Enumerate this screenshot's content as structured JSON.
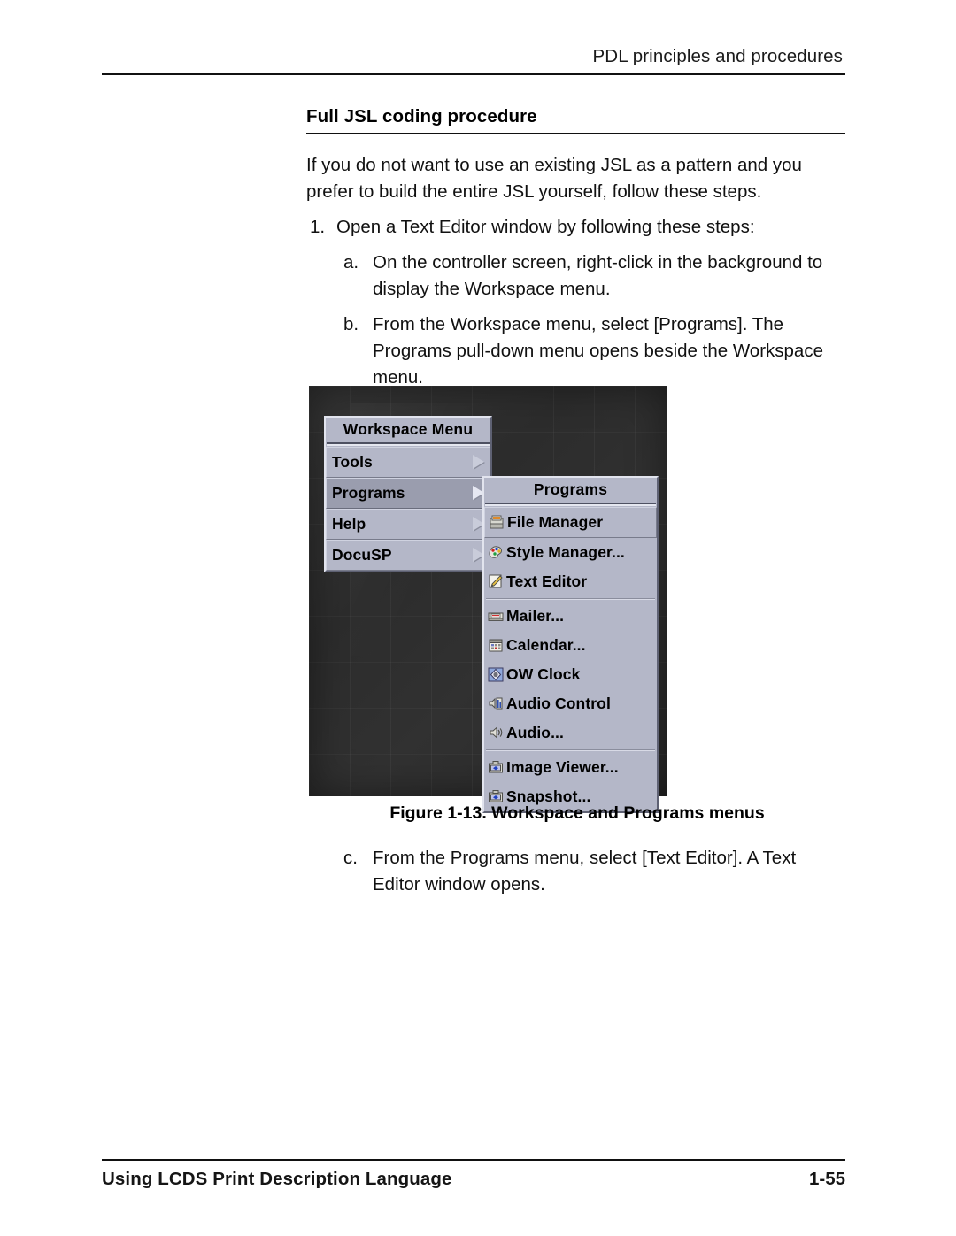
{
  "page": {
    "header_text": "PDL principles and procedures",
    "heading": "Full JSL coding procedure",
    "footer_left": "Using LCDS Print Description Language",
    "footer_page": "1-55"
  },
  "body": {
    "intro": "If you do not want to use an existing JSL as a pattern and you prefer to build the entire JSL yourself, follow these steps.",
    "step1_marker": "1.",
    "step1_text": "Open a Text Editor window by following these steps:",
    "step_a_marker": "a.",
    "step_a_text": "On the controller screen, right-click in the background to display the Workspace menu.",
    "step_b_marker": "b.",
    "step_b_text": "From the Workspace menu, select [Programs]. The Programs pull-down menu opens beside the Workspace menu.",
    "step_c_marker": "c.",
    "step_c_text": "From the Programs menu, select [Text Editor]. A Text Editor window opens."
  },
  "figure": {
    "caption": "Figure 1-13.  Workspace and Programs menus",
    "workspace_menu": {
      "title": "Workspace Menu",
      "items": [
        {
          "label": "Tools",
          "submenu": true,
          "selected": false
        },
        {
          "label": "Programs",
          "submenu": true,
          "selected": true
        },
        {
          "label": "Help",
          "submenu": true,
          "selected": false
        },
        {
          "label": "DocuSP",
          "submenu": true,
          "selected": false
        }
      ]
    },
    "programs_menu": {
      "title": "Programs",
      "items": [
        {
          "label": "File Manager",
          "icon": "file-manager-icon",
          "selected": true
        },
        {
          "label": "Style Manager...",
          "icon": "style-manager-icon",
          "selected": false
        },
        {
          "label": "Text Editor",
          "icon": "text-editor-icon",
          "selected": false
        },
        {
          "label": "Mailer...",
          "icon": "mailer-icon",
          "selected": false
        },
        {
          "label": "Calendar...",
          "icon": "calendar-icon",
          "selected": false
        },
        {
          "label": "OW Clock",
          "icon": "clock-icon",
          "selected": false
        },
        {
          "label": "Audio Control",
          "icon": "audio-control-icon",
          "selected": false
        },
        {
          "label": "Audio...",
          "icon": "audio-icon",
          "selected": false
        },
        {
          "label": "Image Viewer...",
          "icon": "image-viewer-icon",
          "selected": false
        },
        {
          "label": "Snapshot...",
          "icon": "snapshot-icon",
          "selected": false
        }
      ]
    },
    "colors": {
      "menu_face": "#b4b7c8",
      "menu_highlight": "#9a9dae",
      "desktop": "#2e2e2e"
    }
  }
}
